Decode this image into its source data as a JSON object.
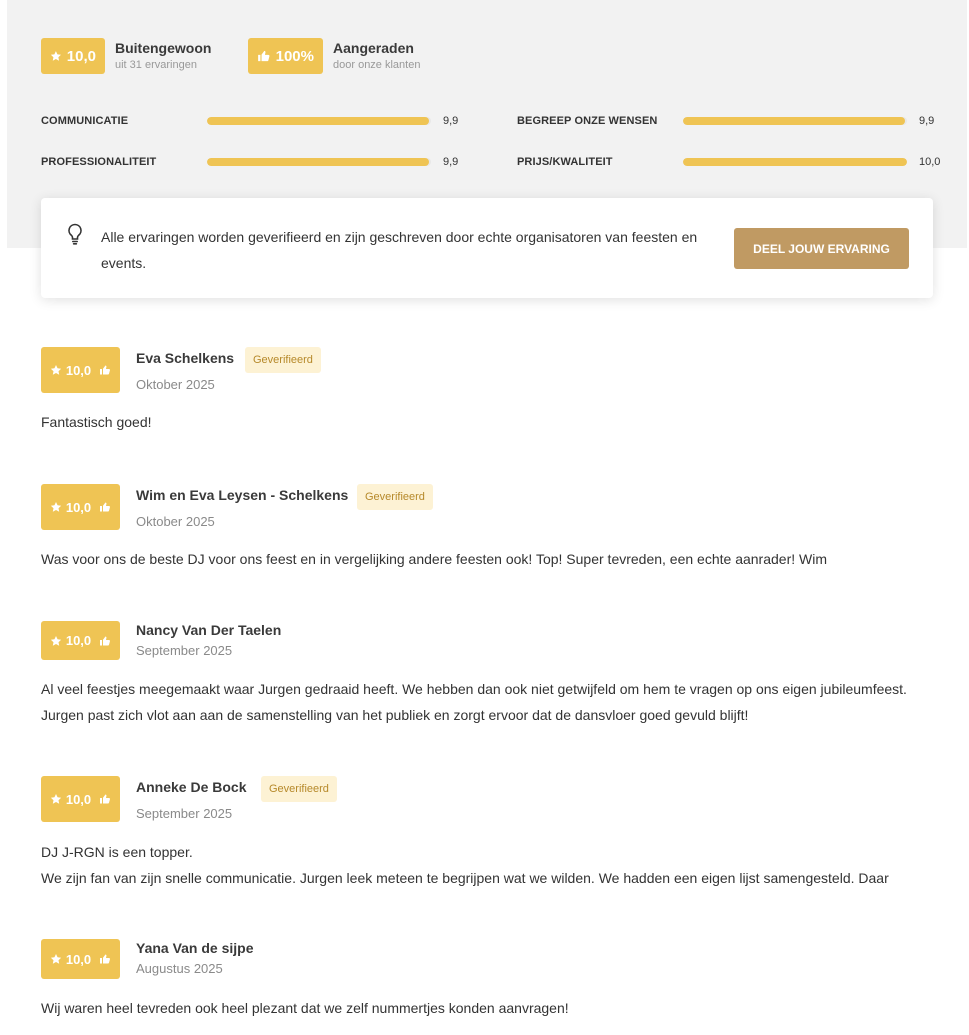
{
  "summary": {
    "rating": {
      "value": "10,0",
      "title": "Buitengewoon",
      "subtitle": "uit 31 ervaringen"
    },
    "recommend": {
      "value": "100%",
      "title": "Aangeraden",
      "subtitle": "door onze klanten"
    },
    "metrics": [
      {
        "label": "Communicatie",
        "value": "9,9",
        "fill": 0.99
      },
      {
        "label": "Begreep onze wensen",
        "value": "9,9",
        "fill": 0.99
      },
      {
        "label": "Professionaliteit",
        "value": "9,9",
        "fill": 0.99
      },
      {
        "label": "Prijs/kwaliteit",
        "value": "10,0",
        "fill": 1.0
      }
    ]
  },
  "info": {
    "text": "Alle ervaringen worden geverifieerd en zijn geschreven door echte organisatoren van feesten en events.",
    "button_label": "Deel jouw ervaring"
  },
  "reviews": [
    {
      "score": "10,0",
      "name": "Eva Schelkens",
      "verified": "Geverifieerd",
      "date": "Oktober 2025",
      "body": "Fantastisch goed!"
    },
    {
      "score": "10,0",
      "name": "Wim en Eva Leysen - Schelkens",
      "verified": "Geverifieerd",
      "date": "Oktober 2025",
      "body": "Was voor ons de beste DJ voor ons feest en in vergelijking andere feesten ook! Top! Super tevreden, een echte aanrader! Wim"
    },
    {
      "score": "10,0",
      "name": "Nancy Van Der Taelen",
      "verified": "",
      "date": "September 2025",
      "body": "Al veel feestjes meegemaakt waar Jurgen gedraaid heeft. We hebben dan ook niet getwijfeld om hem te vragen op ons eigen jubileumfeest. Jurgen past zich vlot aan aan de samenstelling van het publiek en zorgt ervoor dat de dansvloer goed gevuld blijft!"
    },
    {
      "score": "10,0",
      "name": "Anneke De Bock",
      "verified": "Geverifieerd",
      "date": "September 2025",
      "body_line1": "DJ J-RGN is een topper.",
      "body_line2": "We zijn fan van zijn snelle communicatie. Jurgen leek meteen te begrijpen wat we wilden. We hadden een eigen lijst samengesteld. Daar"
    },
    {
      "score": "10,0",
      "name": "Yana Van de sijpe",
      "verified": "",
      "date": "Augustus 2025",
      "body": "Wij waren heel tevreden ook heel plezant dat we zelf nummertjes konden aanvragen!"
    }
  ],
  "colors": {
    "accent": "#efc454",
    "button": "#c09a63",
    "verified_bg": "#fdf2d4",
    "verified_text": "#b6892a"
  },
  "icons": {
    "star": "star-icon",
    "thumb": "thumbs-up-icon",
    "bulb": "lightbulb-icon"
  }
}
